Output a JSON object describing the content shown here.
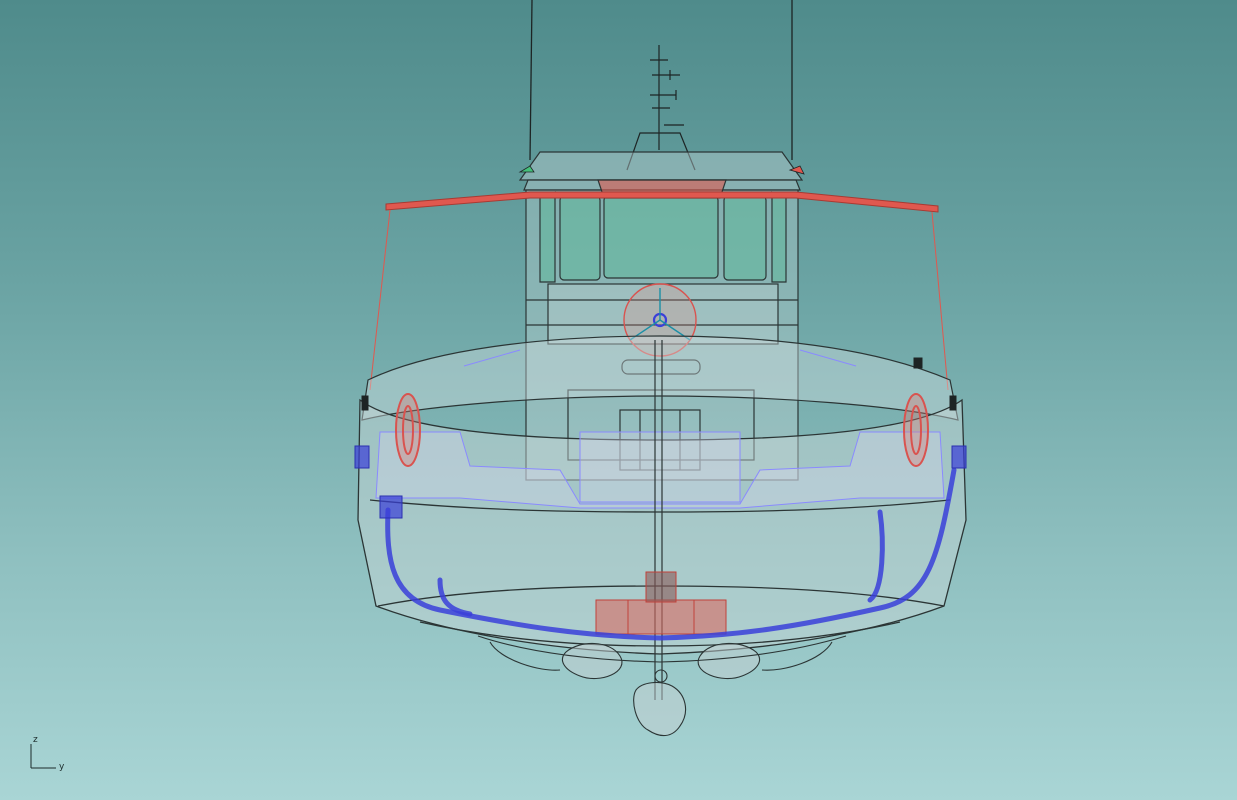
{
  "viewport": {
    "background_top": "#4f8b8b",
    "background_bottom": "#a9d5d5",
    "display_mode": "ghosted"
  },
  "axis_widget": {
    "z_label": "z",
    "y_label": "y"
  },
  "colors": {
    "wireframe": "#2b3535",
    "hull_fill": "#c9d6d8",
    "fender": "#e0584f",
    "pipe": "#3a3fd9",
    "glass": "#5fb89a",
    "lifebuoy": "#d9534f",
    "selection": "#8a8aff"
  }
}
